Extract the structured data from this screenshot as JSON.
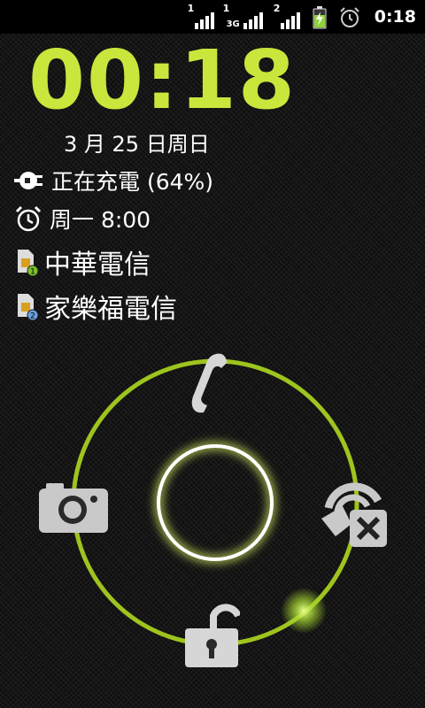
{
  "statusbar": {
    "sim1_label": "1",
    "sim2_label": "2",
    "network_type": "3G",
    "battery_state": "charging",
    "icons": [
      "signal-icon",
      "signal-3g-icon",
      "signal-icon",
      "battery-charging-icon",
      "alarm-icon"
    ],
    "time": "0:18"
  },
  "lockscreen": {
    "clock": "00:18",
    "date": "3 月 25 日周日",
    "charging_status": "正在充電 (64%)",
    "alarm": "周一 8:00",
    "carrier1": "中華電信",
    "carrier2": "家樂福電信",
    "carrier1_badge": "1",
    "carrier2_badge": "2"
  },
  "ring": {
    "targets": [
      "phone-icon",
      "camera-icon",
      "sound-off-icon",
      "unlock-icon"
    ],
    "accent": "#c8e63c"
  }
}
